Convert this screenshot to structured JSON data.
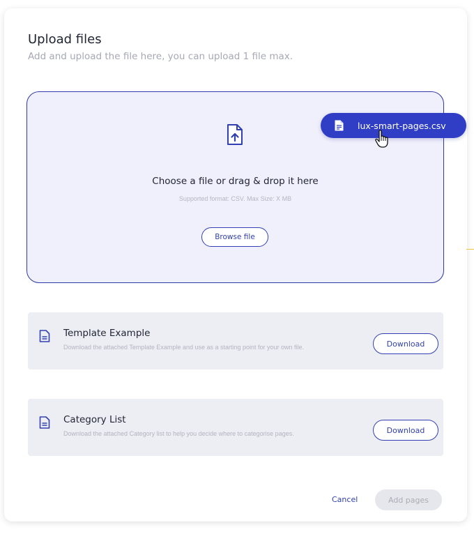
{
  "dialog": {
    "title": "Upload files",
    "subtitle": "Add and upload the file here, you can upload 1 file max."
  },
  "dropzone": {
    "icon": "file-upload-icon",
    "heading": "Choose a file or drag & drop it here",
    "note": "Supported format: CSV. Max Size: X MB",
    "browse_label": "Browse file"
  },
  "dragged_file": {
    "icon": "file-icon",
    "name": "lux-smart-pages.csv"
  },
  "resources": [
    {
      "icon": "document-icon",
      "title": "Template Example",
      "description": "Download the attached Template Example and use as a starting point for your own file.",
      "button_label": "Download"
    },
    {
      "icon": "document-icon",
      "title": "Category List",
      "description": "Download the attached Category list to help you decide where to categorise pages.",
      "button_label": "Download"
    }
  ],
  "footer": {
    "cancel_label": "Cancel",
    "submit_label": "Add pages"
  },
  "colors": {
    "accent": "#2f3ec4",
    "dropzone_bg": "#f0f0fc",
    "card_bg": "#eceef4",
    "disabled_bg": "#e6e7ec"
  }
}
